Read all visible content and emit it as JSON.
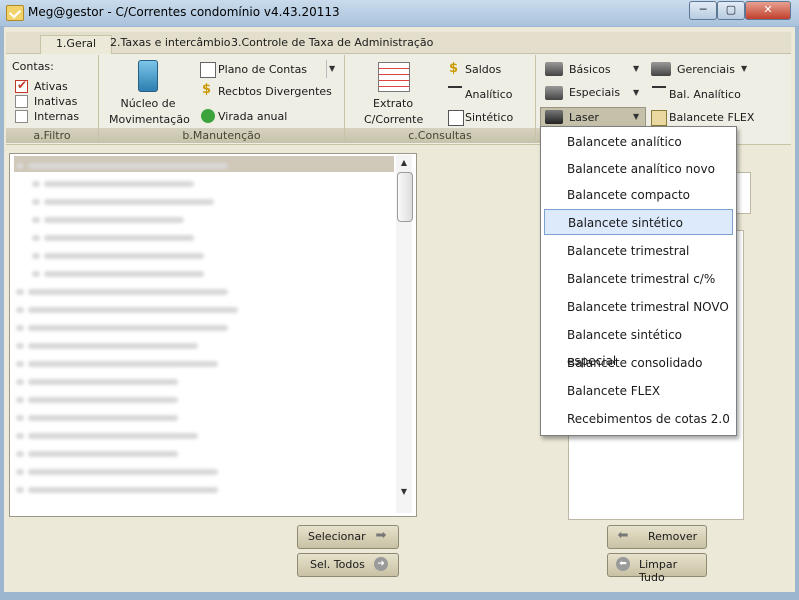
{
  "window": {
    "title": "Meg@gestor - C/Correntes condomínio v4.43.20113",
    "min": "─",
    "max": "▢",
    "close": "✕"
  },
  "tabs": [
    {
      "label": "1.Geral"
    },
    {
      "label": "2.Taxas e intercâmbio"
    },
    {
      "label": "3.Controle de Taxa de Administração"
    }
  ],
  "ribbon": {
    "filtro": {
      "title": "Contas:",
      "options": [
        {
          "label": "Ativas",
          "checked": true
        },
        {
          "label": "Inativas",
          "checked": false
        },
        {
          "label": "Internas",
          "checked": false
        }
      ],
      "group": "a.Filtro"
    },
    "manutencao": {
      "nucleo_line1": "Núcleo de",
      "nucleo_line2": "Movimentação",
      "plano": "Plano de Contas",
      "recibos": "Recbtos Divergentes",
      "virada": "Virada anual",
      "group": "b.Manutenção"
    },
    "consultas": {
      "extrato_line1": "Extrato",
      "extrato_line2": "C/Corrente",
      "saldos": "Saldos",
      "analitico": "Analítico",
      "sintetico": "Sintético",
      "group": "c.Consultas"
    },
    "relatorios": {
      "basicos": "Básicos",
      "especiais": "Especiais",
      "laser": "Laser",
      "gerenciais": "Gerenciais",
      "bal_analitico": "Bal. Analítico",
      "balancete_flex": "Balancete FLEX"
    }
  },
  "menu": {
    "items": [
      {
        "label": "Balancete analítico"
      },
      {
        "label": "Balancete analítico novo"
      },
      {
        "label": "Balancete compacto"
      },
      {
        "label": "Balancete sintético"
      },
      {
        "label": "Balancete trimestral"
      },
      {
        "label": "Balancete trimestral c/%"
      },
      {
        "label": "Balancete trimestral NOVO"
      },
      {
        "label": "Balancete sintético especial"
      },
      {
        "label": "Balancete consolidado"
      },
      {
        "label": "Balancete FLEX"
      },
      {
        "label": "Recebimentos de cotas 2.0"
      }
    ]
  },
  "buttons": {
    "selecionar": "Selecionar",
    "sel_todos": "Sel. Todos",
    "remover": "Remover",
    "limpar": "Limpar Tudo"
  },
  "colors": {
    "accent": "#7da2ce",
    "title_bar": "#b5cce3",
    "checkbox_red": "#c0392b"
  }
}
